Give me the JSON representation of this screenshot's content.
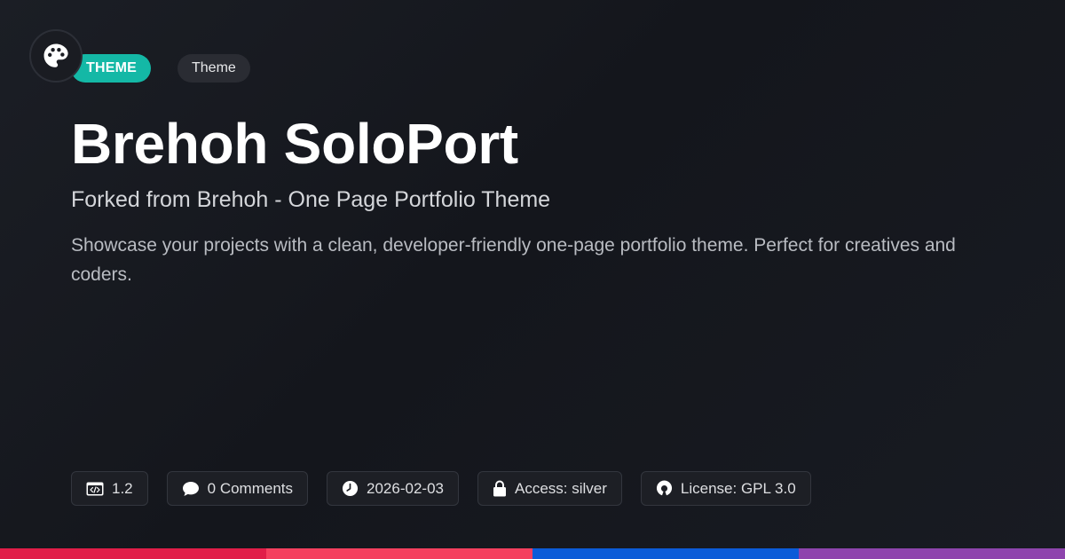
{
  "header": {
    "logo_icon": "palette-icon",
    "type_badge": "THEME",
    "category_badge": "Theme"
  },
  "main": {
    "title": "Brehoh SoloPort",
    "subtitle": "Forked from Brehoh - One Page Portfolio Theme",
    "description": "Showcase your projects with a clean, developer-friendly one-page portfolio theme. Perfect for creatives and coders."
  },
  "meta": [
    {
      "icon": "code-window-icon",
      "label": "1.2"
    },
    {
      "icon": "comment-icon",
      "label": "0 Comments"
    },
    {
      "icon": "clock-icon",
      "label": "2026-02-03"
    },
    {
      "icon": "lock-icon",
      "label": "Access: silver"
    },
    {
      "icon": "open-source-icon",
      "label": "License: GPL 3.0"
    }
  ],
  "colors": {
    "background": "#15171d",
    "accent_teal": "#14b8a6",
    "bar_segments": [
      "#e11d48",
      "#f43f5e",
      "#0b5bd8",
      "#8e44ad"
    ]
  }
}
